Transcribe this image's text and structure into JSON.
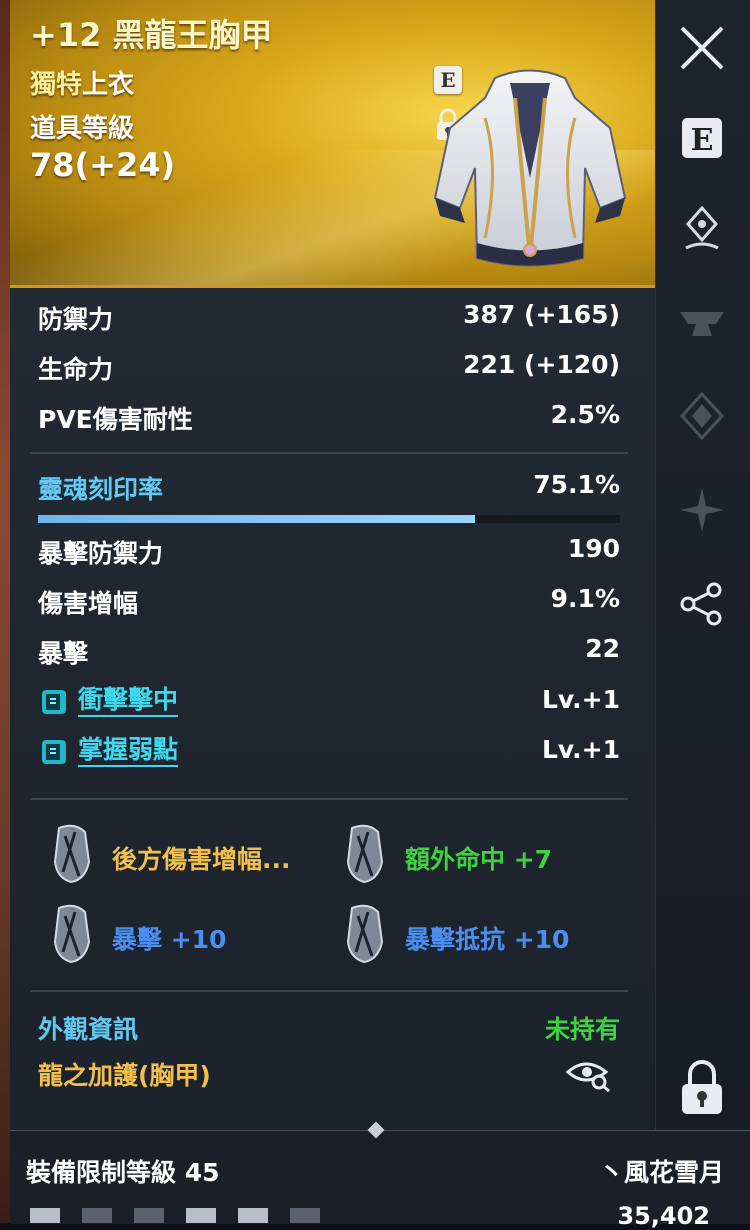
{
  "item": {
    "title": "+12 黑龍王胸甲",
    "rarity": "獨特",
    "type": "上衣",
    "item_level_label": "道具等級",
    "item_level_value": "78(+24)",
    "badge_e": "E"
  },
  "base_stats": [
    {
      "label": "防禦力",
      "value": "387 (+165)"
    },
    {
      "label": "生命力",
      "value": "221 (+120)"
    },
    {
      "label": "PVE傷害耐性",
      "value": "2.5%"
    }
  ],
  "soul": {
    "label": "靈魂刻印率",
    "value": "75.1%",
    "progress": 0.751
  },
  "extra_stats": [
    {
      "label": "暴擊防禦力",
      "value": "190"
    },
    {
      "label": "傷害增幅",
      "value": "9.1%"
    },
    {
      "label": "暴擊",
      "value": "22"
    }
  ],
  "skills": [
    {
      "name": "衝擊擊中",
      "level": "Lv.+1"
    },
    {
      "name": "掌握弱點",
      "level": "Lv.+1"
    }
  ],
  "engravings": [
    {
      "text": "後方傷害增幅...",
      "color": "#f2c04a"
    },
    {
      "text": "額外命中 +7",
      "color": "#3fd23f"
    },
    {
      "text": "暴擊 +10",
      "color": "#4a8ef0"
    },
    {
      "text": "暴擊抵抗 +10",
      "color": "#4a8ef0"
    }
  ],
  "appearance": {
    "label": "外觀資訊",
    "status": "未持有",
    "name": "龍之加護(胸甲)"
  },
  "footer": {
    "requirement": "裝備限制等級 45",
    "seller": "丶風花雪月",
    "gold": "35,402"
  },
  "sidebar_icons": [
    "close-icon",
    "e-badge-icon",
    "pin-icon",
    "anvil-icon",
    "crest-icon",
    "star-icon",
    "share-icon",
    "lock-icon"
  ],
  "colors": {
    "header_gold": "#d9a81a",
    "cyan_label": "#63c9f2",
    "skill_link": "#3fd7ee",
    "green": "#3fd23f",
    "yellow": "#f2c04a",
    "blue": "#4a8ef0"
  }
}
